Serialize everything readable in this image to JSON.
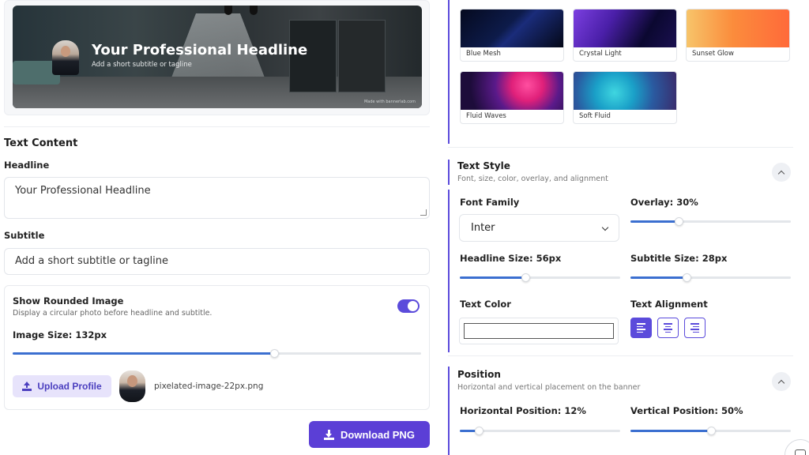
{
  "preview": {
    "headline": "Your Professional Headline",
    "subtitle": "Add a short subtitle or tagline",
    "watermark": "Made with bannerlab.com"
  },
  "text_content": {
    "section_title": "Text Content",
    "headline_label": "Headline",
    "headline_value": "Your Professional Headline",
    "subtitle_label": "Subtitle",
    "subtitle_value": "Add a short subtitle or tagline"
  },
  "image_options": {
    "title": "Show Rounded Image",
    "description": "Display a circular photo before headline and subtitle.",
    "toggle_on": true,
    "size_label": "Image Size: 132px",
    "size_fraction": 0.64,
    "upload_label": "Upload Profile",
    "file_name": "pixelated-image-22px.png"
  },
  "download_label": "Download PNG",
  "backgrounds": [
    {
      "name": "Blue Mesh",
      "gradient": "linear-gradient(135deg,#050a1f 0%,#0d1b4a 45%,#1a2c7a 55%,#040817 100%)"
    },
    {
      "name": "Crystal Light",
      "gradient": "linear-gradient(120deg,#7b3fe0 0%,#4a1fa8 35%,#0b0830 70%,#1a1050 100%)"
    },
    {
      "name": "Sunset Glow",
      "gradient": "linear-gradient(90deg,#f7c46a 0%,#fb8c3c 45%,#ff6a3a 100%)"
    },
    {
      "name": "Fluid Waves",
      "gradient": "radial-gradient(circle at 65% 35%,#ff4fa0 0%,#e0207a 22%,#5a1a8a 45%,#1d0c3a 80%)"
    },
    {
      "name": "Soft Fluid",
      "gradient": "radial-gradient(circle at 40% 55%,#3fd6e0 0%,#1aa0c8 30%,#2a5aa0 60%,#3a2a6a 100%)"
    }
  ],
  "text_style": {
    "title": "Text Style",
    "description": "Font, size, color, overlay, and alignment",
    "font_family_label": "Font Family",
    "font_family_value": "Inter",
    "overlay_label": "Overlay: 30%",
    "overlay_fraction": 0.3,
    "headline_size_label": "Headline Size: 56px",
    "headline_size_fraction": 0.41,
    "subtitle_size_label": "Subtitle Size: 28px",
    "subtitle_size_fraction": 0.35,
    "text_color_label": "Text Color",
    "text_alignment_label": "Text Alignment",
    "alignment_selected": "left"
  },
  "position": {
    "title": "Position",
    "description": "Horizontal and vertical placement on the banner",
    "horizontal_label": "Horizontal Position: 12%",
    "horizontal_fraction": 0.12,
    "vertical_label": "Vertical Position: 50%",
    "vertical_fraction": 0.5
  },
  "colors": {
    "accent": "#5b4bdb",
    "slider_fill": "#3b6fd0"
  }
}
